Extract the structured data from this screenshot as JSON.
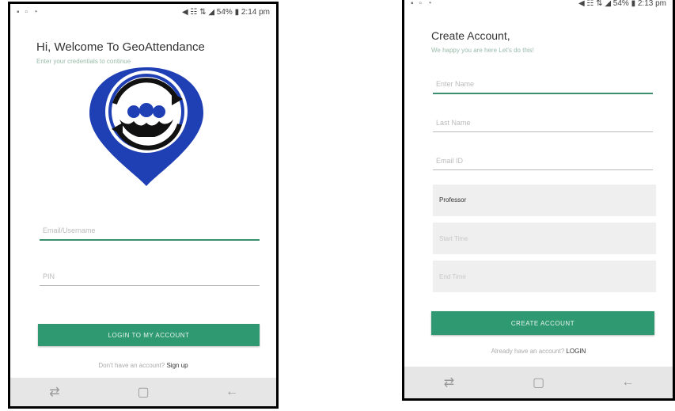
{
  "login": {
    "status": {
      "left_icons": "▪ ▫ ◔",
      "right": "◀ ☷ ⇅ ◢ 54% ▮ 2:14 pm"
    },
    "title": "Hi, Welcome To GeoAttendance",
    "subtitle": "Enter your credentials to continue",
    "username_placeholder": "Email/Username",
    "pin_placeholder": "PIN",
    "login_button": "LOGIN TO MY ACCOUNT",
    "signup_prompt": "Don't have an account?",
    "signup_link": "Sign up",
    "logo_colors": {
      "primary": "#1f3fb4",
      "dark": "#111111"
    }
  },
  "signup": {
    "status": {
      "left_icons": "▪ ▫ ◔",
      "right": "◀ ☷ ⇅ ◢ 54% ▮ 2:13 pm"
    },
    "title": "Create Account,",
    "subtitle": "We happy you are here Let's do this!",
    "fields": {
      "first_name": "Enter Name",
      "last_name": "Last Name",
      "email": "Email ID",
      "role": "Professor",
      "start_time": "Start Time",
      "end_time": "End Time"
    },
    "create_button": "CREATE ACCOUNT",
    "login_prompt": "Already have an account?",
    "login_link": "LOGIN"
  },
  "navbar": {
    "left": "recent-apps-icon",
    "center": "home-icon",
    "right": "back-icon"
  },
  "colors": {
    "accent": "#2f9a72",
    "underline": "#3a8f6f",
    "field_bg": "#efefef"
  }
}
